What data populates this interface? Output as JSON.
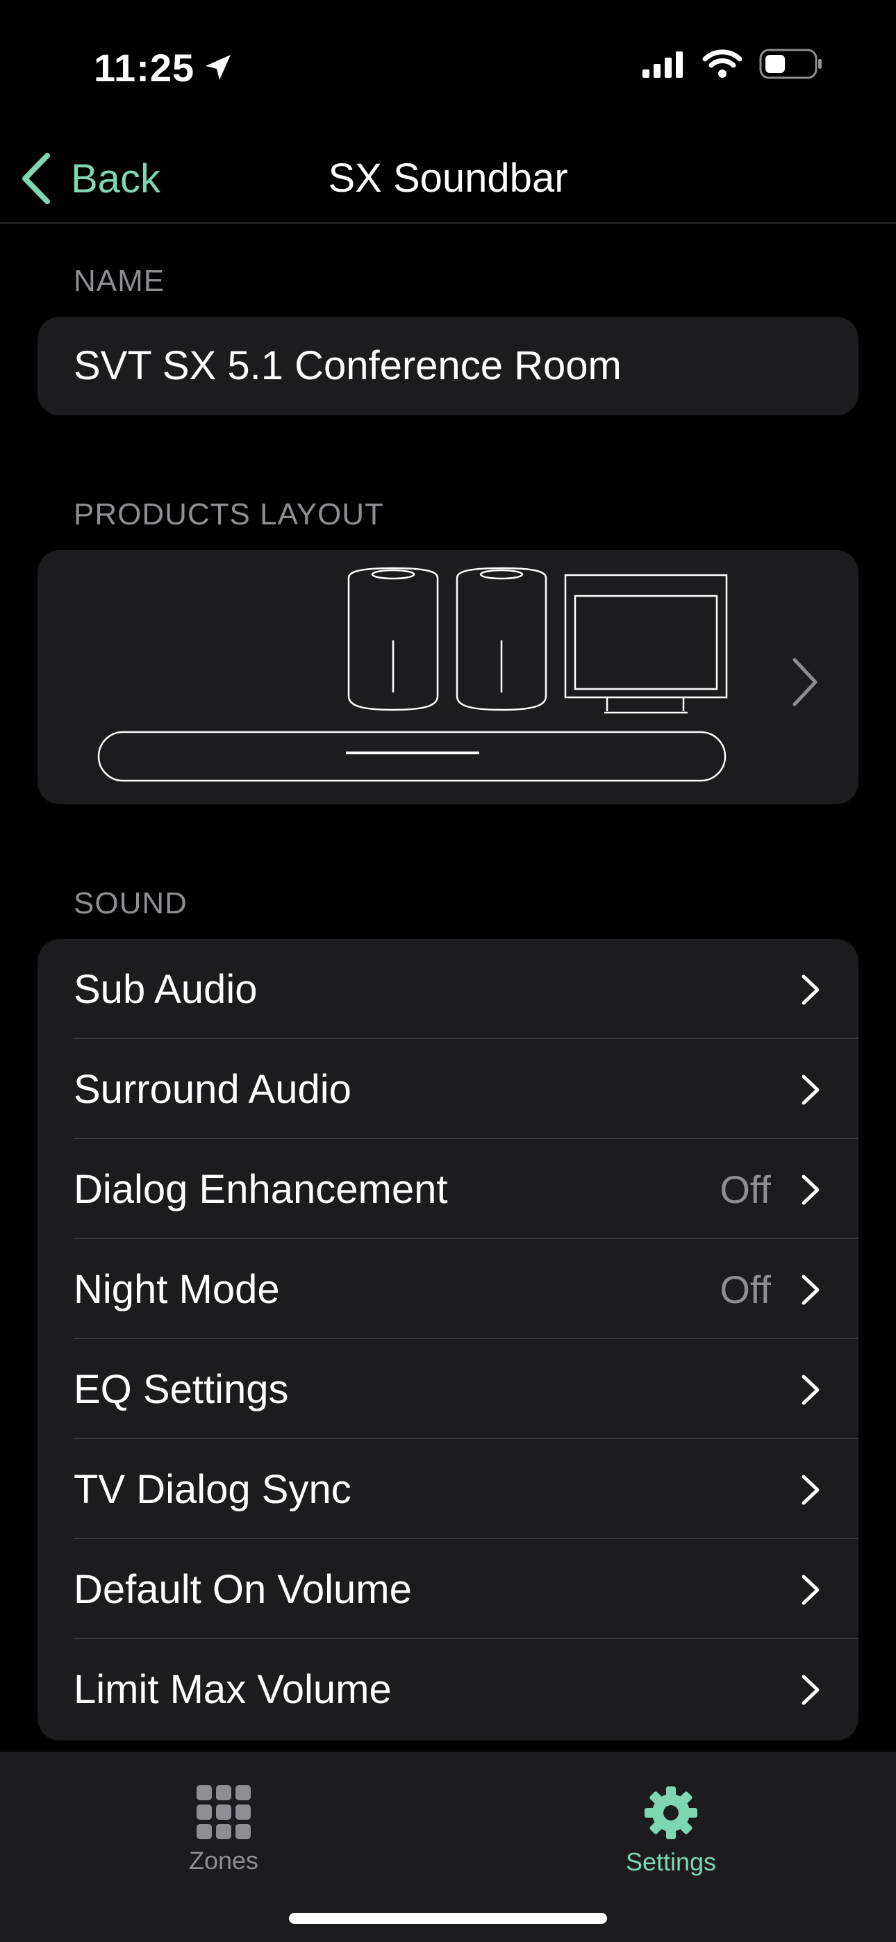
{
  "status_bar": {
    "time": "11:25",
    "icons": [
      "location-arrow-icon",
      "cellular-signal-icon",
      "wifi-icon",
      "battery-icon"
    ]
  },
  "nav": {
    "back_label": "Back",
    "title": "SX Soundbar"
  },
  "name_section": {
    "header": "NAME",
    "value": "SVT SX 5.1 Conference Room"
  },
  "layout_section": {
    "header": "PRODUCTS LAYOUT"
  },
  "sound_section": {
    "header": "SOUND",
    "items": [
      {
        "label": "Sub Audio",
        "value": ""
      },
      {
        "label": "Surround Audio",
        "value": ""
      },
      {
        "label": "Dialog Enhancement",
        "value": "Off"
      },
      {
        "label": "Night Mode",
        "value": "Off"
      },
      {
        "label": "EQ Settings",
        "value": ""
      },
      {
        "label": "TV Dialog Sync",
        "value": ""
      },
      {
        "label": "Default On Volume",
        "value": ""
      },
      {
        "label": "Limit Max Volume",
        "value": ""
      }
    ]
  },
  "tab_bar": {
    "tabs": [
      {
        "label": "Zones",
        "icon": "grid-icon",
        "active": false
      },
      {
        "label": "Settings",
        "icon": "gear-icon",
        "active": true
      }
    ]
  },
  "colors": {
    "accent": "#7fd6b2",
    "background": "#000000",
    "card": "#1c1c1e",
    "secondary_text": "#8e8e93"
  }
}
